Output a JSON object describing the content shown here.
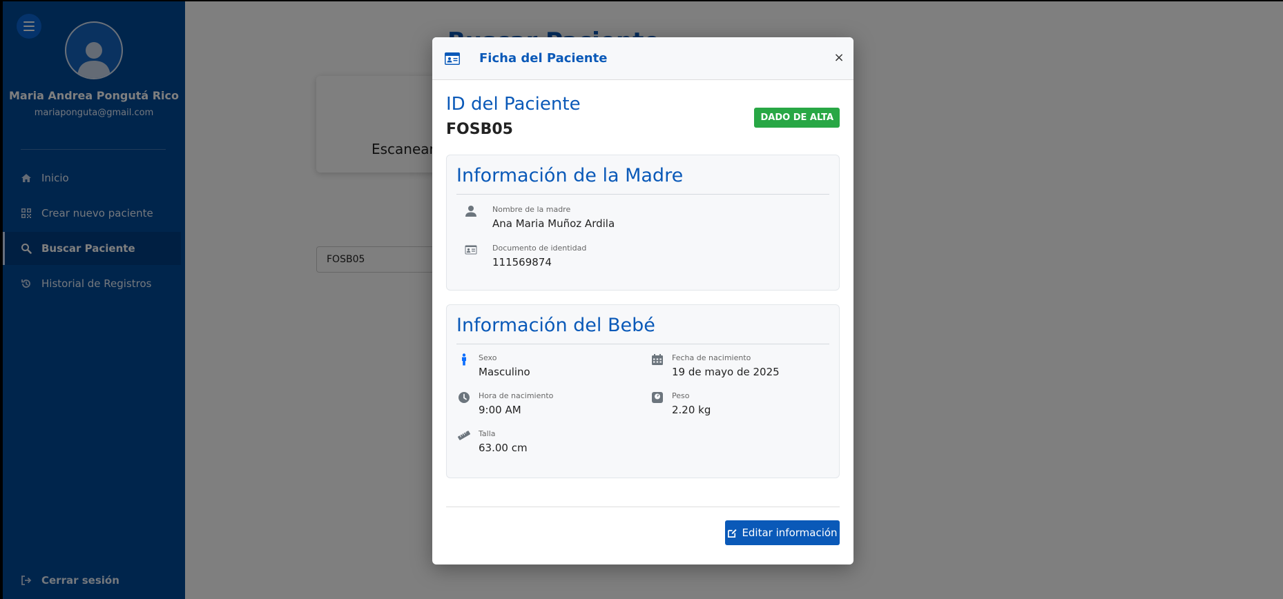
{
  "sidebar": {
    "user_name": "Maria Andrea Pongutá Rico",
    "user_email": "mariaponguta@gmail.com",
    "items": [
      {
        "label": "Inicio",
        "icon": "home-icon"
      },
      {
        "label": "Crear nuevo paciente",
        "icon": "qrcode-icon"
      },
      {
        "label": "Buscar Paciente",
        "icon": "search-icon",
        "active": true
      },
      {
        "label": "Historial de Registros",
        "icon": "history-icon"
      }
    ],
    "logout_label": "Cerrar sesión"
  },
  "main": {
    "page_title": "Buscar Paciente",
    "scan_text": "Escanear",
    "search_value": "FOSB05"
  },
  "modal": {
    "title": "Ficha del Paciente",
    "close_label": "×",
    "id_label": "ID del Paciente",
    "id_value": "FOSB05",
    "status_badge": "DADO DE ALTA",
    "mother": {
      "title": "Información de la Madre",
      "name_label": "Nombre de la madre",
      "name_value": "Ana Maria Muñoz Ardila",
      "doc_label": "Documento de identidad",
      "doc_value": "111569874"
    },
    "baby": {
      "title": "Información del Bebé",
      "sex_label": "Sexo",
      "sex_value": "Masculino",
      "birthdate_label": "Fecha de nacimiento",
      "birthdate_value": "19 de mayo de 2025",
      "birthtime_label": "Hora de nacimiento",
      "birthtime_value": "9:00 AM",
      "weight_label": "Peso",
      "weight_value": "2.20 kg",
      "height_label": "Talla",
      "height_value": "63.00 cm"
    },
    "edit_button": "Editar información"
  },
  "colors": {
    "sidebar_bg": "#004a99",
    "accent_blue": "#0a59b8",
    "badge_green": "#28a745"
  }
}
